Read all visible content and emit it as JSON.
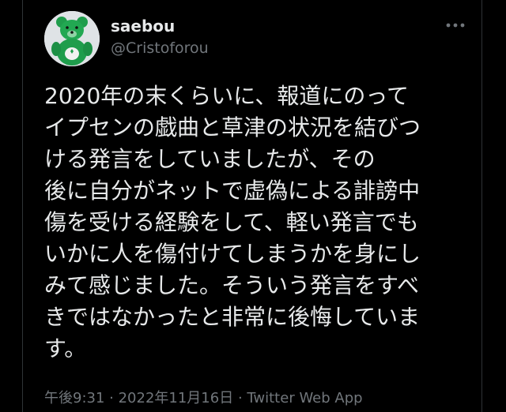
{
  "user": {
    "display_name": "saebou",
    "handle": "@Cristoforou",
    "avatar_icon": "green-bear-avatar-icon"
  },
  "menu": {
    "icon": "more-dots-icon"
  },
  "tweet": {
    "lines": [
      "2020年の末くらいに、報道にのって",
      "イプセンの戯曲と草津の状況を結びつ",
      "ける発言をしていましたが、その",
      "後に自分がネットで虚偽による誹謗中",
      "傷を受ける経験をして、軽い発言でも",
      "いかに人を傷付けてしまうかを身にし",
      "みて感じました。そういう発言をすべ",
      "きではなかったと非常に後悔していま",
      "す。"
    ]
  },
  "meta": {
    "time": "午後9:31",
    "sep1": " · ",
    "date": "2022年11月16日",
    "sep2": " · ",
    "source": "Twitter Web App"
  },
  "colors": {
    "background": "#000000",
    "text": "#e7e9ea",
    "muted": "#71767b",
    "avatar_green": "#1f9d4c"
  }
}
